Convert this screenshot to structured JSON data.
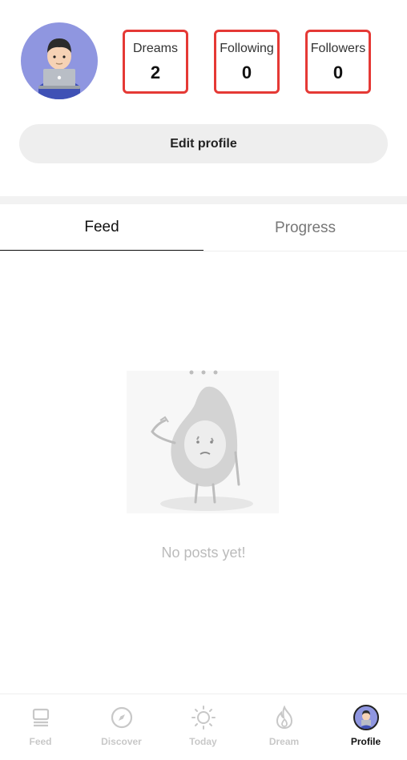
{
  "profile": {
    "stats": [
      {
        "label": "Dreams",
        "value": "2"
      },
      {
        "label": "Following",
        "value": "0"
      },
      {
        "label": "Followers",
        "value": "0"
      }
    ],
    "edit_label": "Edit profile"
  },
  "tabs": [
    {
      "label": "Feed",
      "active": true
    },
    {
      "label": "Progress",
      "active": false
    }
  ],
  "empty_state": {
    "message": "No posts yet!"
  },
  "bottom_nav": [
    {
      "label": "Feed",
      "icon": "feed-icon"
    },
    {
      "label": "Discover",
      "icon": "compass-icon"
    },
    {
      "label": "Today",
      "icon": "sun-icon"
    },
    {
      "label": "Dream",
      "icon": "flame-icon"
    },
    {
      "label": "Profile",
      "icon": "avatar",
      "active": true
    }
  ],
  "colors": {
    "highlight": "#e53935",
    "avatar_bg": "#8f96e0",
    "inactive": "#c8c8c8"
  }
}
